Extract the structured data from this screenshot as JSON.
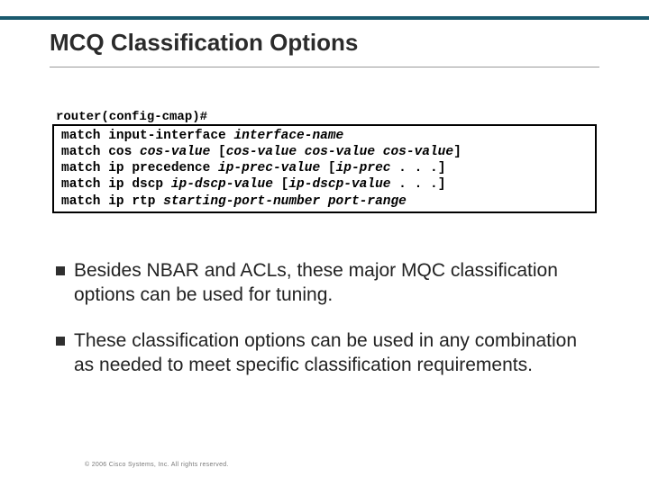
{
  "title": "MCQ Classification Options",
  "prompt": "router(config-cmap)#",
  "code": {
    "lines": [
      {
        "kw": "match input-interface ",
        "arg": "interface-name"
      },
      {
        "kw": "match cos ",
        "arg": "cos-value ",
        "tail_kw": "[",
        "tail_arg": "cos-value cos-value cos-value",
        "tail_close": "]"
      },
      {
        "kw": "match ip precedence ",
        "arg": "ip-prec-value ",
        "tail_kw": "[",
        "tail_arg": "ip-prec",
        "tail_close": " . . .]"
      },
      {
        "kw": "match ip dscp ",
        "arg": "ip-dscp-value ",
        "tail_kw": "[",
        "tail_arg": "ip-dscp-value",
        "tail_close": " . . .]"
      },
      {
        "kw": "match ip rtp ",
        "arg": "starting-port-number port-range"
      }
    ]
  },
  "bullets": [
    "Besides NBAR and ACLs, these major MQC classification options can be used for tuning.",
    "These classification options can be used in any combination as needed to meet specific classification requirements."
  ],
  "footer": "© 2006 Cisco Systems, Inc. All rights reserved."
}
